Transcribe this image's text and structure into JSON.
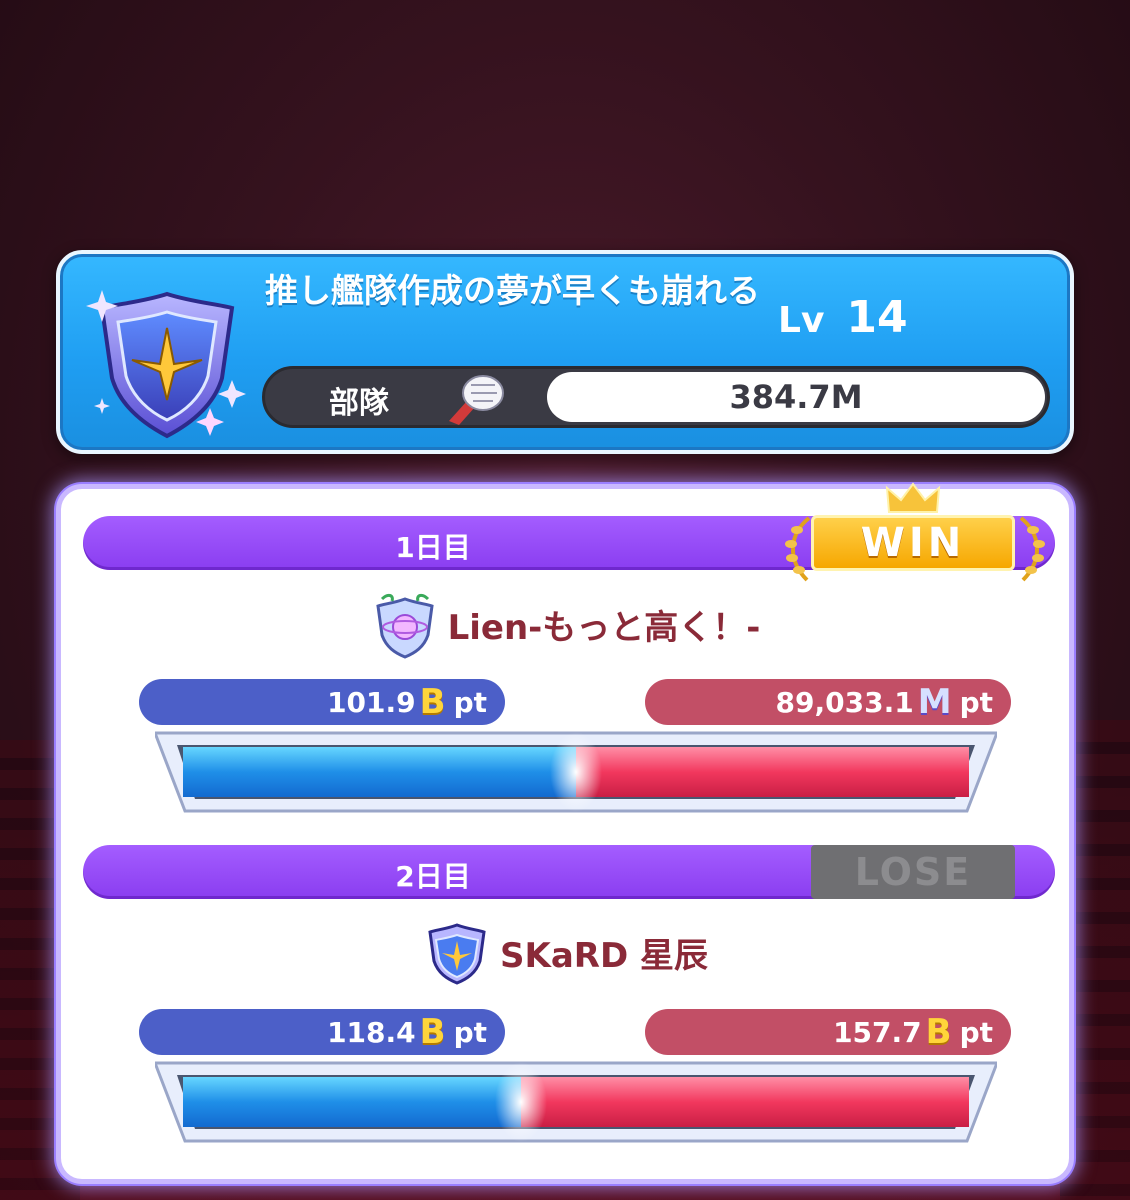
{
  "team": {
    "name": "推し艦隊作成の夢が早くも崩れる",
    "level_label": "Lv",
    "level_value": "14",
    "power_label": "部隊",
    "power_value": "384.7M"
  },
  "days": [
    {
      "label": "1日目",
      "result": "WIN",
      "opponent_name": "Lien-もっと高く！-",
      "my_score": "101.9",
      "my_unit": "B",
      "their_score": "89,033.1",
      "their_unit": "M",
      "pt_label": "pt",
      "my_share": 0.5
    },
    {
      "label": "2日目",
      "result": "LOSE",
      "opponent_name": "SKaRD 星辰",
      "my_score": "118.4",
      "my_unit": "B",
      "their_score": "157.7",
      "their_unit": "B",
      "pt_label": "pt",
      "my_share": 0.43
    }
  ],
  "colors": {
    "team_panel": "#1f9ef2",
    "day_header": "#8a3df0",
    "win": "#f6a700",
    "lose": "#6f6f72",
    "mine": "#4c5fc8",
    "theirs": "#c24f66"
  }
}
